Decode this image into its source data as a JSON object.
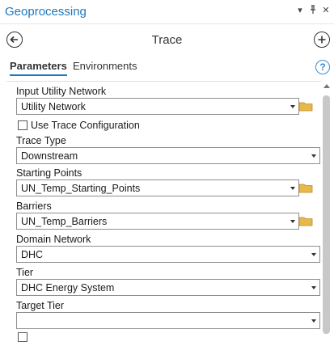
{
  "header": {
    "title": "Geoprocessing",
    "menu_icon": "chevron-down-icon",
    "pin_icon": "pin-icon",
    "close_icon": "close-icon"
  },
  "nav": {
    "tool_title": "Trace",
    "back_icon": "back-arrow-icon",
    "add_icon": "add-icon"
  },
  "tabs": [
    {
      "label": "Parameters",
      "active": true
    },
    {
      "label": "Environments",
      "active": false
    }
  ],
  "help_icon_text": "?",
  "params": {
    "input_utility_network": {
      "label": "Input Utility Network",
      "value": "Utility Network"
    },
    "use_trace_configuration": {
      "label": "Use Trace Configuration",
      "checked": false
    },
    "trace_type": {
      "label": "Trace Type",
      "value": "Downstream"
    },
    "starting_points": {
      "label": "Starting Points",
      "value": "UN_Temp_Starting_Points"
    },
    "barriers": {
      "label": "Barriers",
      "value": "UN_Temp_Barriers"
    },
    "domain_network": {
      "label": "Domain Network",
      "value": "DHC"
    },
    "tier": {
      "label": "Tier",
      "value": "DHC Energy System"
    },
    "target_tier": {
      "label": "Target Tier",
      "value": ""
    }
  },
  "colors": {
    "accent": "#1e78be",
    "folder": "#e8b84a"
  }
}
